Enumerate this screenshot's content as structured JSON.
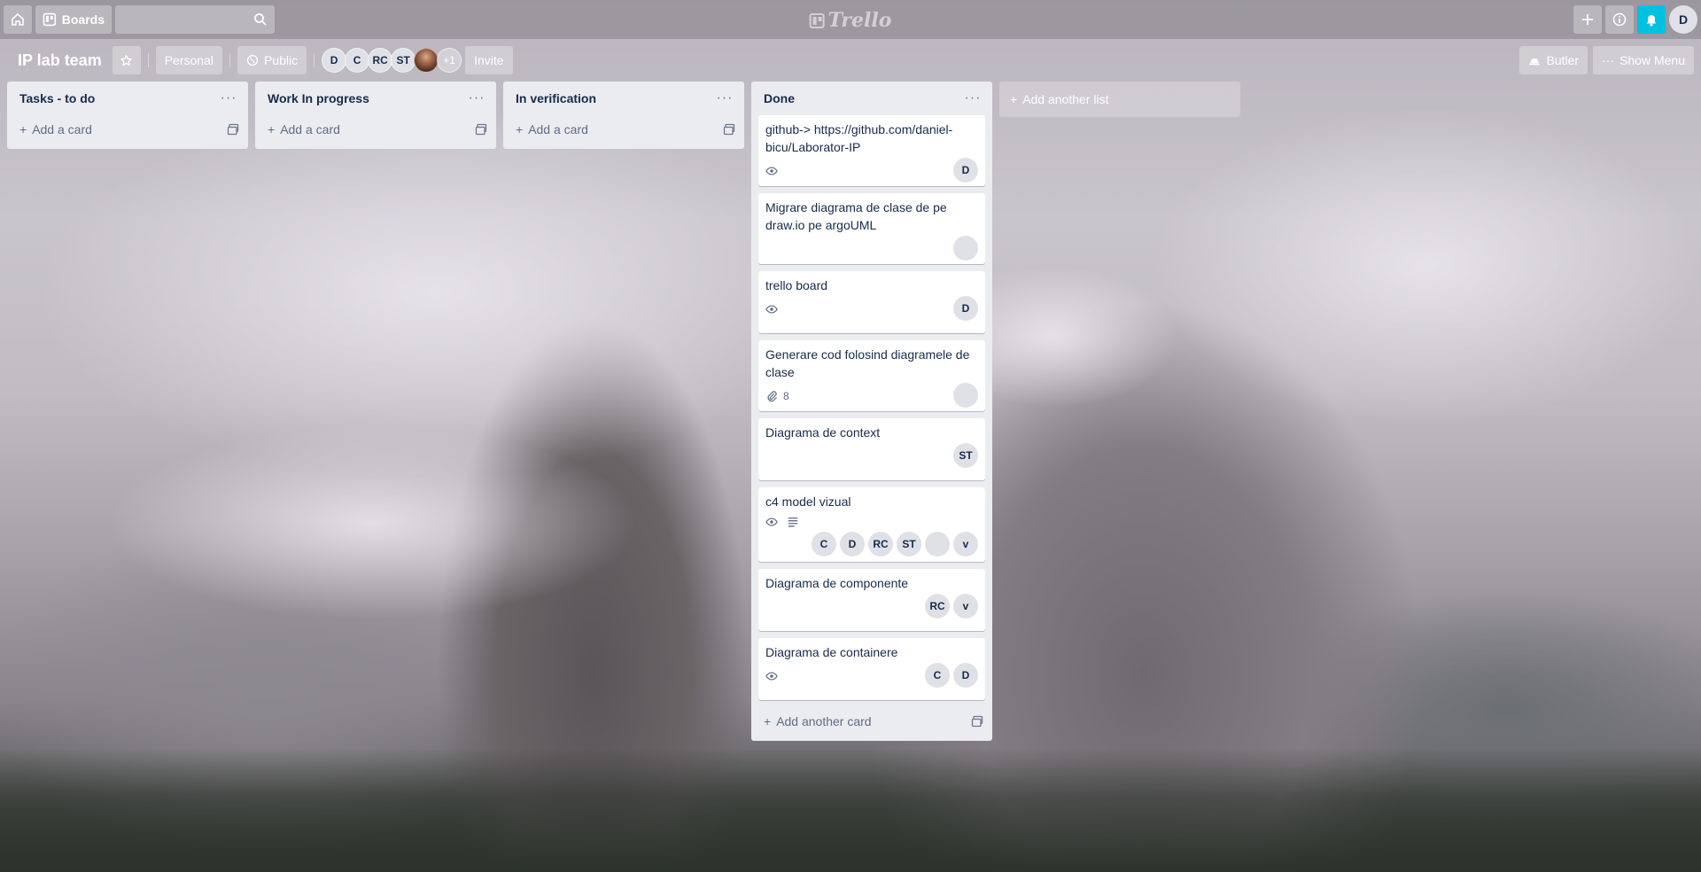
{
  "header": {
    "boards_label": "Boards",
    "search_value": "",
    "logo_text": "Trello",
    "user_initial": "D"
  },
  "board": {
    "title": "IP lab team",
    "team_label": "Personal",
    "visibility_label": "Public",
    "members": [
      "D",
      "C",
      "RC",
      "ST"
    ],
    "more_members": "+1",
    "invite_label": "Invite",
    "butler_label": "Butler",
    "show_menu_label": "Show Menu"
  },
  "lists": [
    {
      "title": "Tasks - to do",
      "add_card": "Add a card"
    },
    {
      "title": "Work In progress",
      "add_card": "Add a card"
    },
    {
      "title": "In verification",
      "add_card": "Add a card"
    },
    {
      "title": "Done",
      "add_card": "Add another card",
      "cards": [
        {
          "title": "github-> https://github.com/daniel-bicu/Laborator-IP",
          "members": [
            "D"
          ]
        },
        {
          "title": "Migrare diagrama de clase de pe draw.io pe argoUML",
          "members": []
        },
        {
          "title": "trello board",
          "members": [
            "D"
          ]
        },
        {
          "title": "Generare cod folosind diagramele de clase",
          "attachments": "8",
          "members": []
        },
        {
          "title": "Diagrama de context",
          "members": [
            "ST"
          ]
        },
        {
          "title": "c4 model vizual",
          "members": [
            "C",
            "D",
            "RC",
            "ST",
            "v"
          ]
        },
        {
          "title": "Diagrama de componente",
          "members": [
            "RC",
            "v"
          ]
        },
        {
          "title": "Diagrama de containere",
          "members": [
            "C",
            "D"
          ]
        }
      ]
    }
  ],
  "add_list_label": "Add another list"
}
